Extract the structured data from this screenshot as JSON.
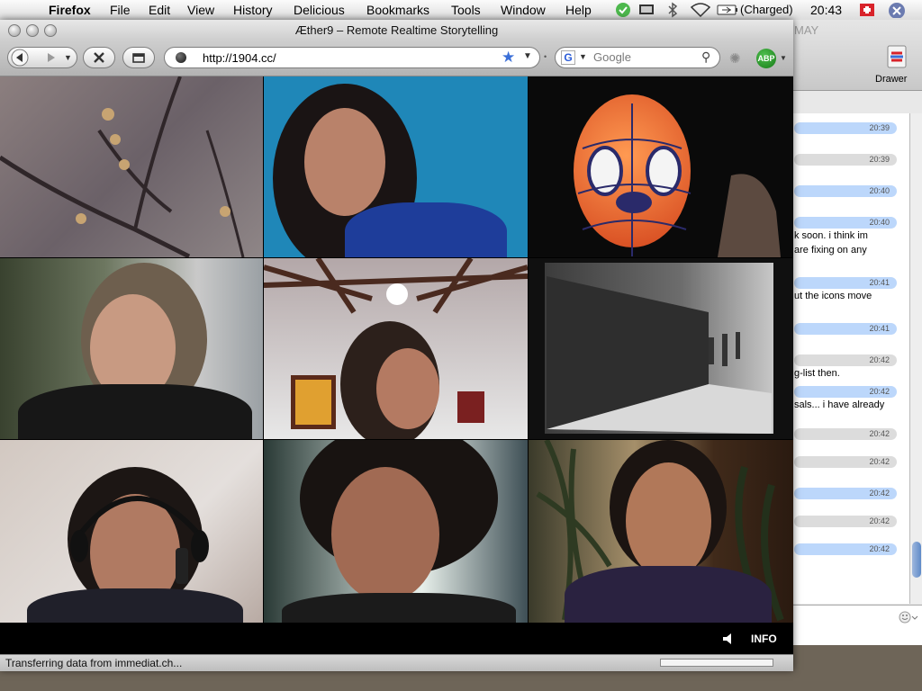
{
  "menubar": {
    "apple_glyph": "",
    "app_name": "Firefox",
    "items": [
      "File",
      "Edit",
      "View",
      "History",
      "Delicious",
      "Bookmarks",
      "Tools",
      "Window",
      "Help"
    ],
    "battery": "(Charged)",
    "clock": "20:43"
  },
  "browser": {
    "title": "Æther9 – Remote Realtime Storytelling",
    "url": "http://1904.cc/",
    "search_placeholder": "Google",
    "abp_label": "ABP",
    "status": "Transferring data from immediat.ch...",
    "progress": 0
  },
  "player": {
    "info_label": "INFO"
  },
  "chat": {
    "header_text": "MAY",
    "drawer_label": "Drawer",
    "times": [
      "20:39",
      "20:39",
      "20:40",
      "20:40",
      "20:41",
      "20:41",
      "20:42",
      "20:42",
      "20:42",
      "20:42",
      "20:42",
      "20:42",
      "20:42"
    ],
    "lines": [
      "k soon. i think im",
      " are fixing on any",
      "ut the icons move",
      "g-list then.",
      "sals... i have already"
    ]
  }
}
